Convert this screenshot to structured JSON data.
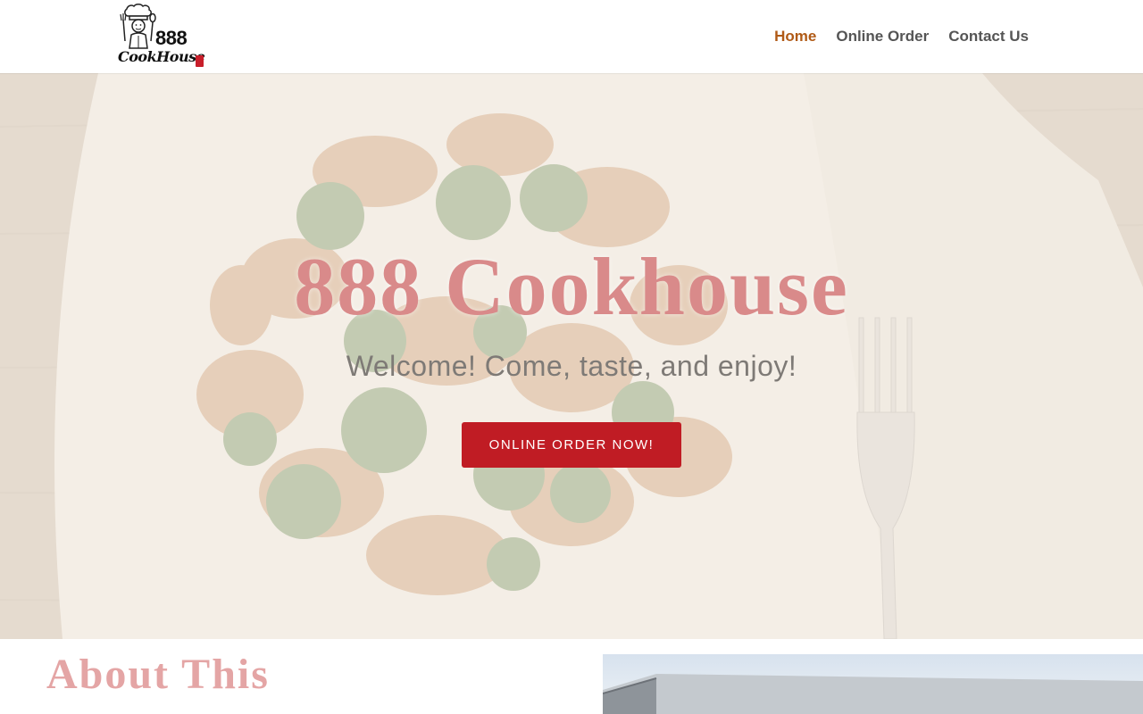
{
  "header": {
    "logo": {
      "number": "888",
      "wordmark": "CookHouse"
    },
    "nav": [
      {
        "label": "Home",
        "active": true
      },
      {
        "label": "Online Order",
        "active": false
      },
      {
        "label": "Contact Us",
        "active": false
      }
    ]
  },
  "hero": {
    "title": "888 Cookhouse",
    "subtitle": "Welcome! Come, taste, and enjoy!",
    "cta_label": "ONLINE ORDER NOW!"
  },
  "about": {
    "title": "About This"
  },
  "colors": {
    "accent": "#c01c24",
    "nav_active": "#b05a16",
    "nav_text": "#555555",
    "hero_title": "#d98a8a",
    "about_title": "#e4a5a5"
  }
}
